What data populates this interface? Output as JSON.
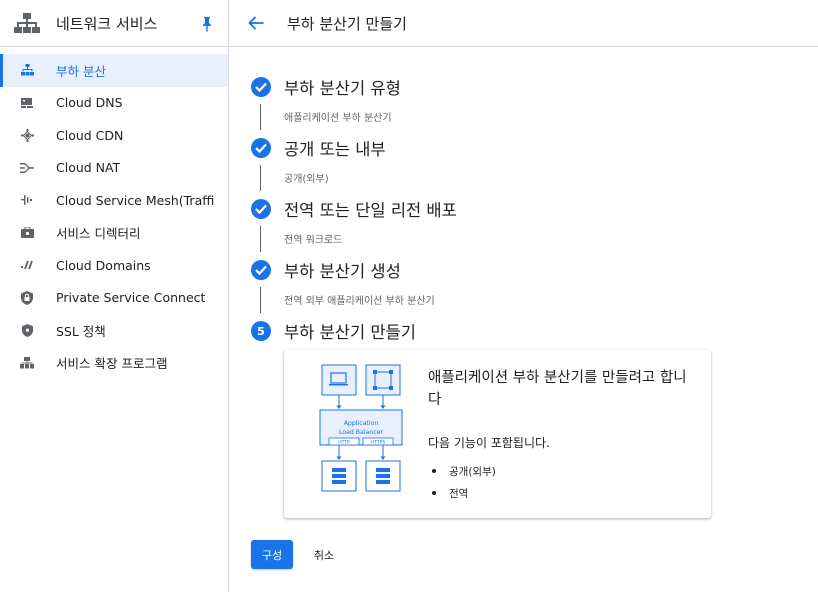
{
  "sidebar": {
    "title": "네트워크 서비스",
    "items": [
      {
        "label": "부하 분산",
        "icon": "load-balancer-icon",
        "active": true
      },
      {
        "label": "Cloud DNS",
        "icon": "dns-icon"
      },
      {
        "label": "Cloud CDN",
        "icon": "cdn-icon"
      },
      {
        "label": "Cloud NAT",
        "icon": "nat-icon"
      },
      {
        "label": "Cloud Service Mesh(Traffi...",
        "icon": "service-mesh-icon"
      },
      {
        "label": "서비스 디렉터리",
        "icon": "service-directory-icon"
      },
      {
        "label": "Cloud Domains",
        "icon": "domains-icon"
      },
      {
        "label": "Private Service Connect",
        "icon": "private-service-connect-icon"
      },
      {
        "label": "SSL 정책",
        "icon": "ssl-shield-icon"
      },
      {
        "label": "서비스 확장 프로그램",
        "icon": "service-extensions-icon"
      }
    ]
  },
  "header": {
    "title": "부하 분산기 만들기"
  },
  "steps": [
    {
      "title": "부하 분산기 유형",
      "subtitle": "애플리케이션 부하 분산기",
      "status": "complete"
    },
    {
      "title": "공개 또는 내부",
      "subtitle": "공개(외부)",
      "status": "complete"
    },
    {
      "title": "전역 또는 단일 리전 배포",
      "subtitle": "전역 워크로드",
      "status": "complete"
    },
    {
      "title": "부하 분산기 생성",
      "subtitle": "전역 외부 애플리케이션 부하 분산기",
      "status": "complete"
    },
    {
      "title": "부하 분산기 만들기",
      "number": "5",
      "status": "current"
    }
  ],
  "card": {
    "heading": "애플리케이션 부하 분산기를 만들려고 합니다",
    "includes_label": "다음 기능이 포함됩니다.",
    "features": [
      "공개(외부)",
      "전역"
    ],
    "diagram": {
      "line1": "Application",
      "line2": "Load Balancer",
      "http": "HTTP",
      "https": "HTTPS"
    }
  },
  "actions": {
    "configure": "구성",
    "cancel": "취소"
  },
  "colors": {
    "accent": "#1a73e8",
    "active_bg": "#e8f0fe",
    "diagram_bg": "#e8f0fe"
  }
}
